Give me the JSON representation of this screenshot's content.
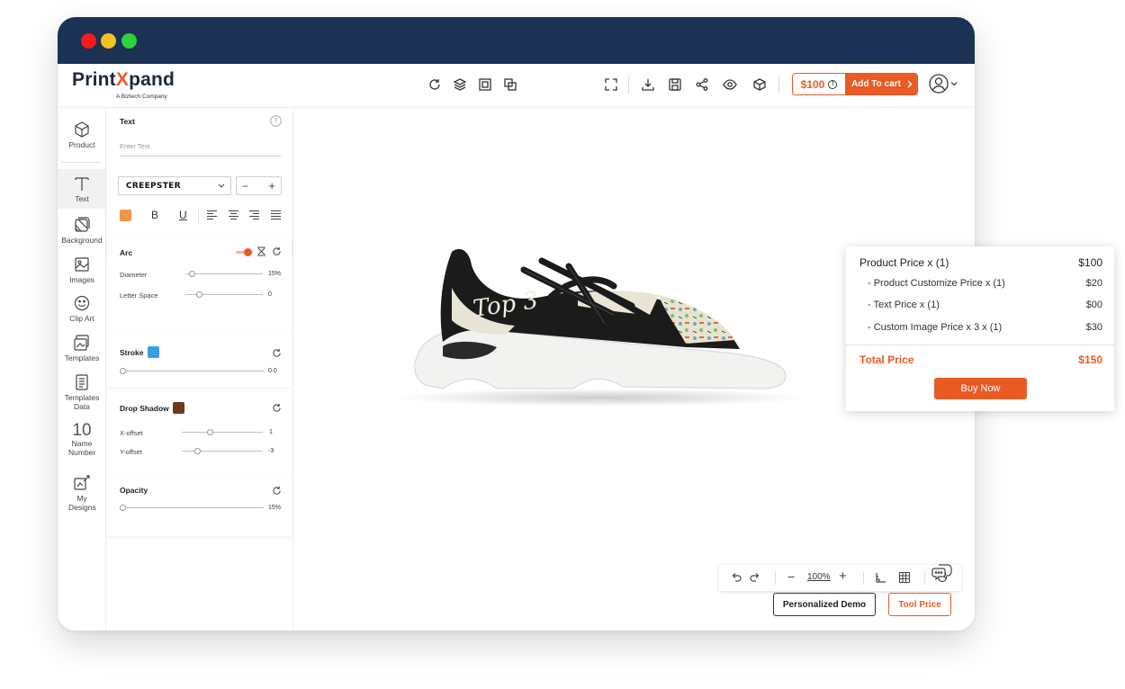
{
  "brand": {
    "name_prefix": "Print",
    "name_x": "X",
    "name_suffix": "pand",
    "tagline": "A Biztech Company",
    "accent_color": "#e85b24",
    "titlebar_color": "#1b3254"
  },
  "toolbar": {
    "price_label": "$100",
    "add_to_cart_label": "Add To cart",
    "icons": [
      "refresh-icon",
      "layers-icon",
      "align-icon",
      "arrange-icon",
      "fullscreen-icon",
      "download-icon",
      "save-icon",
      "share-icon",
      "preview-icon",
      "3d-view-icon",
      "info-icon",
      "user-icon"
    ]
  },
  "sidebar": {
    "items": [
      {
        "label": "Product",
        "icon": "cube-icon"
      },
      {
        "label": "Text",
        "icon": "text-icon",
        "active": true
      },
      {
        "label": "Background",
        "icon": "background-icon"
      },
      {
        "label": "Images",
        "icon": "image-icon"
      },
      {
        "label": "Clip Art",
        "icon": "smiley-icon"
      },
      {
        "label": "Templates",
        "icon": "templates-icon"
      },
      {
        "label": "Templates Data",
        "icon": "templates-data-icon"
      },
      {
        "label": "Name Number",
        "number": "10"
      },
      {
        "label": "My Designs",
        "icon": "my-designs-icon"
      }
    ]
  },
  "text_panel": {
    "title": "Text",
    "input_placeholder": "Enter Text",
    "font_value": "CREEPSTER",
    "text_color": "#f0974b",
    "arc": {
      "label": "Arc",
      "enabled": true,
      "diameter_label": "Diameter",
      "diameter_value": "15%",
      "diameter_fraction": 0.05,
      "letter_space_label": "Letter Space",
      "letter_space_value": "0",
      "letter_space_fraction": 0.15
    },
    "stroke": {
      "label": "Stroke",
      "color": "#3a9fe0",
      "value": "0.0"
    },
    "drop_shadow": {
      "label": "Drop Shadow",
      "color": "#6b3b1c",
      "x_label": "X-offset",
      "x_value": "1",
      "y_label": "Y-offset",
      "y_value": "-3"
    },
    "opacity": {
      "label": "Opacity",
      "value": "15%"
    }
  },
  "canvas": {
    "product_text": "Top 3",
    "zoom": "100%",
    "demo_button": "Personalized Demo",
    "tool_price_button": "Tool Price"
  },
  "price_panel": {
    "rows": [
      {
        "label": "Product Price  x  (1)",
        "value": "$100"
      },
      {
        "label": "- Product Customize Price  x  (1)",
        "value": "$20"
      },
      {
        "label": "- Text Price x (1)",
        "value": "$00"
      },
      {
        "label": "- Custom Image Price x 3 x  (1)",
        "value": "$30"
      }
    ],
    "total_label": "Total Price",
    "total_value": "$150",
    "buy_label": "Buy Now"
  }
}
